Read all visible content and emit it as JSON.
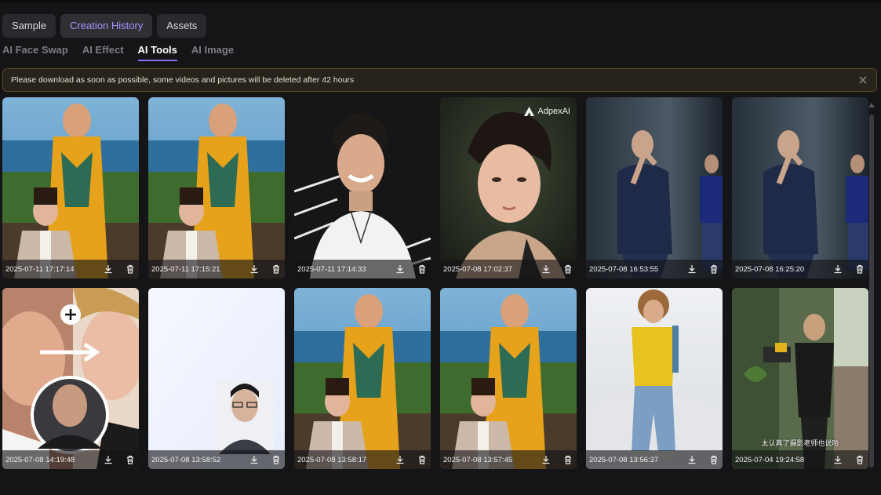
{
  "main_tabs": [
    {
      "label": "Sample",
      "active": false
    },
    {
      "label": "Creation History",
      "active": true
    },
    {
      "label": "Assets",
      "active": false
    }
  ],
  "sub_tabs": [
    {
      "label": "AI Face Swap",
      "active": false
    },
    {
      "label": "AI Effect",
      "active": false
    },
    {
      "label": "AI Tools",
      "active": true
    },
    {
      "label": "AI Image",
      "active": false
    }
  ],
  "notice": {
    "text": "Please download as soon as possible, some videos and pictures will be deleted after 42 hours",
    "close_icon": "close-icon"
  },
  "cards": [
    {
      "date": "2025-07-11 17:17:14",
      "thumb": "beach-dress-woman"
    },
    {
      "date": "2025-07-11 17:15:21",
      "thumb": "beach-dress-woman"
    },
    {
      "date": "2025-07-11 17:14:33",
      "thumb": "smiling-man-dark"
    },
    {
      "date": "2025-07-08 17:02:37",
      "thumb": "portrait-man-watermark",
      "watermark": "AdpexAI"
    },
    {
      "date": "2025-07-08 16:53:55",
      "thumb": "man-suit-smoking"
    },
    {
      "date": "2025-07-08 16:25:20",
      "thumb": "man-suit-smoking"
    },
    {
      "date": "2025-07-08 14:19:48",
      "thumb": "face-swap-collage"
    },
    {
      "date": "2025-07-08 13:58:52",
      "thumb": "blank-with-id-photo"
    },
    {
      "date": "2025-07-08 13:58:17",
      "thumb": "beach-dress-woman"
    },
    {
      "date": "2025-07-08 13:57:45",
      "thumb": "beach-dress-woman"
    },
    {
      "date": "2025-07-08 13:56:37",
      "thumb": "curly-boy-yellow-shirt"
    },
    {
      "date": "2025-07-04 19:24:58",
      "thumb": "photographer-room",
      "subtitle": "太认真了摄影老师也说哈"
    }
  ],
  "icons": {
    "download": "download-icon",
    "delete": "trash-icon"
  },
  "colors": {
    "accent": "#8b6cff",
    "notice_bg": "#27231a",
    "background": "#151517"
  }
}
